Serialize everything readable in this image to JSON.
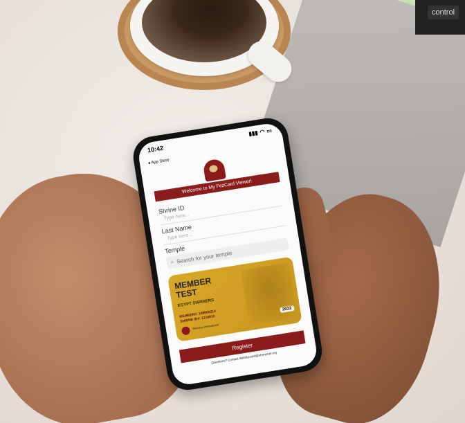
{
  "status_bar": {
    "time": "10:42",
    "back_label": "◂ App Store"
  },
  "app": {
    "welcome": "Welcome to My FezCard Viewer!",
    "shrine_id_label": "Shrine ID",
    "shrine_id_placeholder": "Type here...",
    "last_name_label": "Last Name",
    "last_name_placeholder": "Type here...",
    "temple_label": "Temple",
    "temple_placeholder": "Search for your temple",
    "register_label": "Register",
    "contact_text": "Questions? Contact Webfezcard@shrinenet.org"
  },
  "card": {
    "line1": "MEMBER",
    "line2": "TEST",
    "org": "EGYPT SHRINERS",
    "member_id": "MEMBER#: 198000214",
    "shrine_id": "SHRINE ID#: 1218810",
    "year": "2022",
    "brand": "Shriners International"
  },
  "keyboard": {
    "control": "control"
  }
}
